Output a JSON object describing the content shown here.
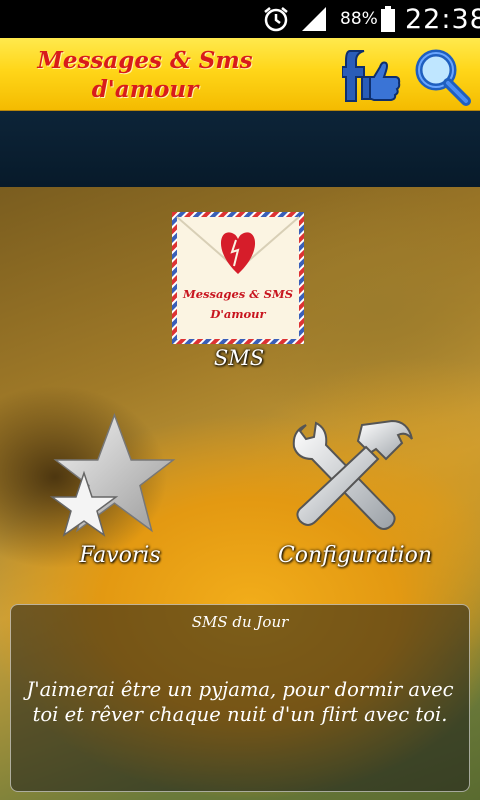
{
  "status_bar": {
    "battery_percent": "88%",
    "time": "22:38",
    "icons": [
      "alarm-icon",
      "signal-icon",
      "battery-icon"
    ]
  },
  "header": {
    "title_line1": "Messages & Sms",
    "title_line2": "d'amour",
    "facebook_icon": "facebook-like-icon",
    "search_icon": "search-icon",
    "colors": {
      "bar": "#ffd619",
      "title": "#d81b1b"
    }
  },
  "menu": {
    "sms": {
      "label": "SMS",
      "card_line1": "Messages & SMS",
      "card_line2": "D'amour",
      "icon": "love-letter-envelope-icon"
    },
    "favorites": {
      "label": "Favoris",
      "icon": "star-icon"
    },
    "configuration": {
      "label": "Configuration",
      "icon": "tools-icon"
    }
  },
  "sms_of_day": {
    "title": "SMS du Jour",
    "text": "J'aimerai être un pyjama, pour dormir avec toi et rêver chaque nuit d'un flirt avec toi."
  }
}
